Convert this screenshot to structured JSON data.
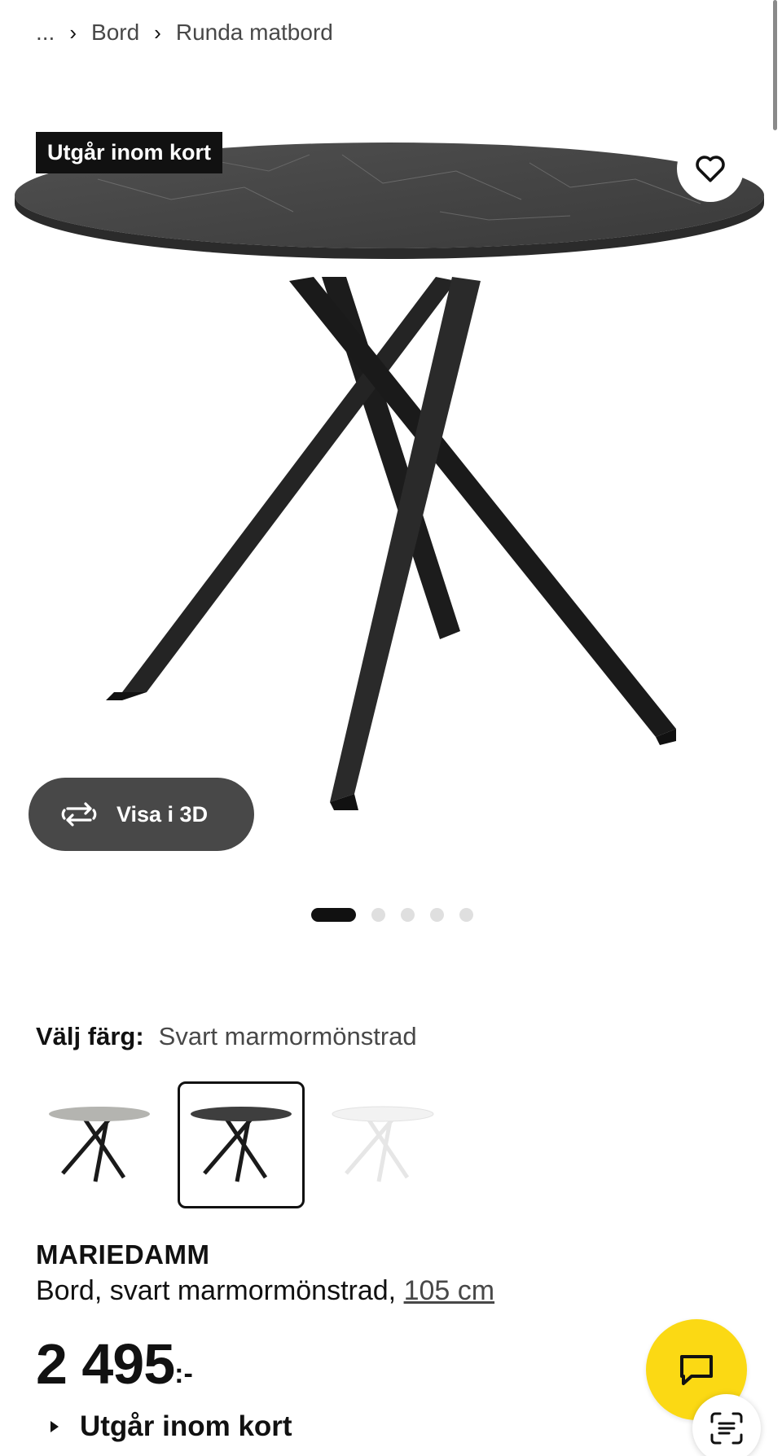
{
  "breadcrumb": {
    "ellipsis": "...",
    "items": [
      "Bord",
      "Runda matbord"
    ]
  },
  "image": {
    "badge": "Utgår inom kort",
    "view_3d_label": "Visa i 3D",
    "carousel": {
      "total": 5,
      "active": 1
    }
  },
  "color": {
    "label": "Välj färg:",
    "value": "Svart marmormönstrad",
    "options": [
      "grey-marble",
      "black-marble",
      "white-marble"
    ],
    "selected": 1
  },
  "product": {
    "name": "MARIEDAMM",
    "description": "Bord, svart marmormönstrad, ",
    "size": "105 cm"
  },
  "price": {
    "value": "2 495",
    "suffix": ":-"
  },
  "availability": {
    "status": "Utgår inom kort"
  },
  "colors": {
    "accent_yellow": "#fbd914",
    "dark": "#111111",
    "button_grey": "#484848"
  },
  "icons": [
    "chevron-right-icon",
    "heart-icon",
    "rotate-3d-icon",
    "chat-icon",
    "scan-icon",
    "triangle-right-icon"
  ]
}
